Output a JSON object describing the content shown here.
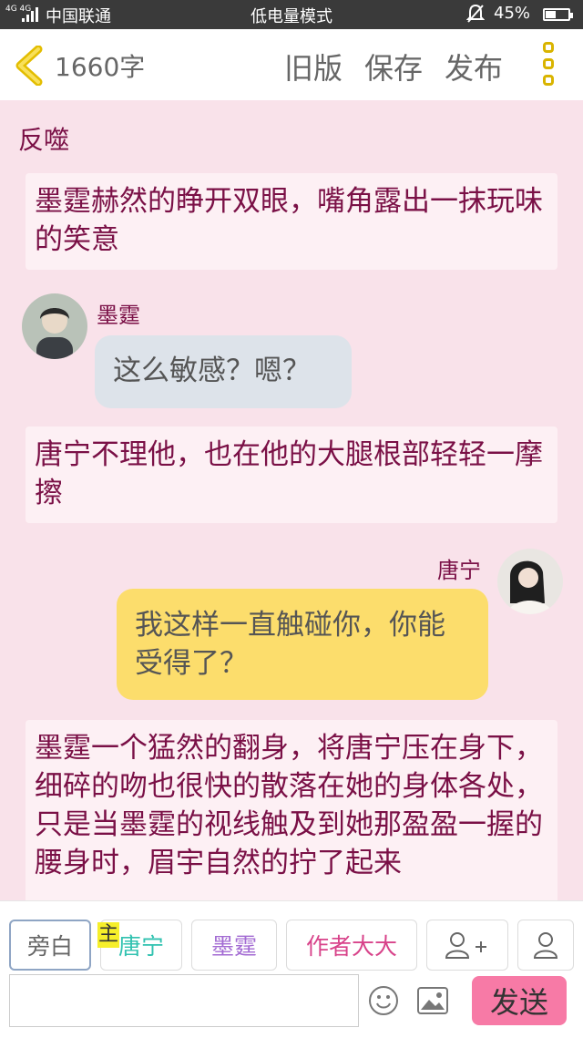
{
  "status": {
    "network": "4G 4G",
    "carrier": "中国联通",
    "mode": "低电量模式",
    "battery": "45%"
  },
  "topbar": {
    "word_count": "1660字",
    "old_version": "旧版",
    "save": "保存",
    "publish": "发布"
  },
  "section": {
    "title": "反噬"
  },
  "messages": [
    {
      "type": "narration",
      "text": "墨霆赫然的睁开双眼，嘴角露出一抹玩味的笑意"
    },
    {
      "type": "left",
      "name": "墨霆",
      "text": "这么敏感？嗯？"
    },
    {
      "type": "narration",
      "text": "唐宁不理他，也在他的大腿根部轻轻一摩擦"
    },
    {
      "type": "right",
      "name": "唐宁",
      "text": "我这样一直触碰你，你能受得了？"
    },
    {
      "type": "narration",
      "text": "墨霆一个猛然的翻身，将唐宁压在身下，细碎的吻也很快的散落在她的身体各处，只是当墨霆的视线触及到她那盈盈一握的腰身时，眉宇自然的拧了起来"
    }
  ],
  "roles": {
    "narrator": "旁白",
    "main_badge": "主",
    "tangning": "唐宁",
    "moting": "墨霆",
    "author": "作者大大"
  },
  "composer": {
    "send": "发送",
    "input_value": ""
  },
  "colors": {
    "accent_pink": "#f77aa6",
    "text_maroon": "#7a1046",
    "left_bubble": "#dde3ea",
    "right_bubble": "#fcdd6c"
  }
}
